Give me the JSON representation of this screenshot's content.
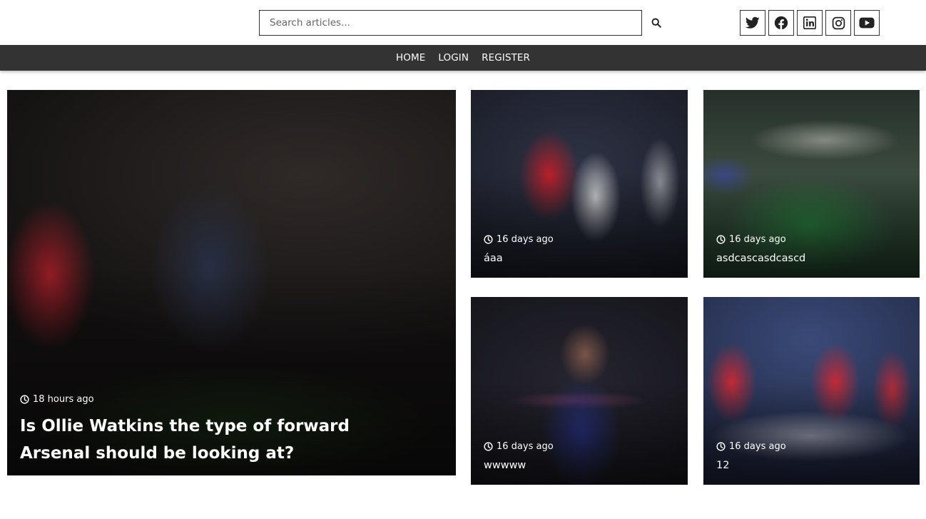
{
  "search": {
    "placeholder": "Search articles..."
  },
  "icons": {
    "search": "search-icon",
    "social": [
      "twitter-icon",
      "facebook-icon",
      "linkedin-icon",
      "instagram-icon",
      "youtube-icon"
    ],
    "clock": "clock-icon"
  },
  "nav": {
    "items": [
      "HOME",
      "LOGIN",
      "REGISTER"
    ]
  },
  "colors": {
    "navbar": "#333333",
    "text_on_image": "#ffffff"
  },
  "featured": {
    "time": "18 hours ago",
    "title": "Is Ollie Watkins the type of forward Arsenal should be looking at?"
  },
  "articles": [
    {
      "time": "16 days ago",
      "title": "áaa"
    },
    {
      "time": "16 days ago",
      "title": "asdcascasdcascd"
    },
    {
      "time": "16 days ago",
      "title": "wwwww"
    },
    {
      "time": "16 days ago",
      "title": "12"
    }
  ]
}
